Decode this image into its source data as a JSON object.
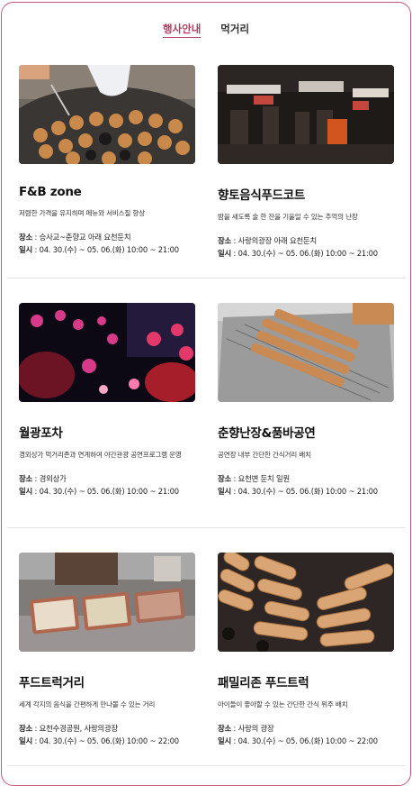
{
  "tabs": [
    {
      "label": "행사안내",
      "active": true
    },
    {
      "label": "먹거리",
      "active": false
    }
  ],
  "cards": [
    {
      "title": "F&B zone",
      "desc": "저렴한 가격을 유지하며 메뉴와 서비스질 향상",
      "place_label": "장소",
      "place": "승사교~춘향교 아래 요천둔치",
      "date_label": "일시",
      "date": "04. 30.(수) ~ 05. 06.(화) 10:00 ~ 21:00",
      "image": "takoyaki-grill-photo"
    },
    {
      "title": "향토음식푸드코트",
      "desc": "밤을 새도록 술 한 잔을 기울일 수 있는 추억의 난장",
      "place_label": "장소",
      "place": "사랑의광장 아래 요천둔치",
      "date_label": "일시",
      "date": "04. 30.(수) ~ 05. 06.(화) 10:00 ~ 21:00",
      "image": "night-food-court-photo"
    },
    {
      "title": "월광포차",
      "desc": "경외상가 먹거리존과 연계하여 야간관광 공연프로그램 운영",
      "place_label": "장소",
      "place": "경외상가",
      "date_label": "일시",
      "date": "04. 30.(수) ~ 05. 06.(화) 10:00 ~ 21:00",
      "image": "lantern-night-photo"
    },
    {
      "title": "춘향난장&품바공연",
      "desc": "공연장 내부 간단한 간식거리 배치",
      "place_label": "장소",
      "place": "요천변 둔치 일원",
      "date_label": "일시",
      "date": "04. 30.(수) ~ 05. 06.(화) 10:00 ~ 21:00",
      "image": "skewer-grill-photo"
    },
    {
      "title": "푸드트럭거리",
      "desc": "세계 각지의 음식을 간편하게 만나볼 수 있는 거리",
      "place_label": "장소",
      "place": "요천수경공원, 사랑의광장",
      "date_label": "일시",
      "date": "04. 30.(수) ~ 05. 06.(화) 10:00 ~ 22:00",
      "image": "food-truck-trays-photo"
    },
    {
      "title": "패밀리존 푸드트럭",
      "desc": "아이들이 좋아할 수 있는 간단한 간식 위주 배치",
      "place_label": "장소",
      "place": "사랑의 광장",
      "date_label": "일시",
      "date": "04. 30.(수) ~ 05. 06.(화) 10:00 ~ 22:00",
      "image": "sausage-grill-photo"
    }
  ],
  "colors": {
    "accent": "#b23d5e",
    "frame_border": "#c9587a"
  }
}
